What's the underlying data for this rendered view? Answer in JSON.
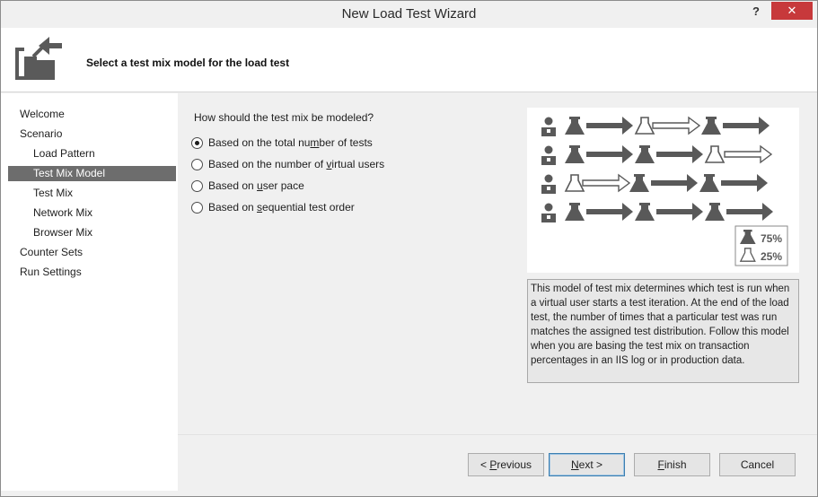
{
  "window": {
    "title": "New Load Test Wizard",
    "help_glyph": "?",
    "close_glyph": "✕"
  },
  "header": {
    "heading": "Select a test mix model for the load test",
    "icon": "wizard-icon"
  },
  "nav": {
    "items": [
      {
        "label": "Welcome",
        "level": "top"
      },
      {
        "label": "Scenario",
        "level": "top"
      },
      {
        "label": "Load Pattern",
        "level": "sub"
      },
      {
        "label": "Test Mix Model",
        "level": "sub",
        "selected": true
      },
      {
        "label": "Test Mix",
        "level": "sub"
      },
      {
        "label": "Network Mix",
        "level": "sub"
      },
      {
        "label": "Browser Mix",
        "level": "sub"
      },
      {
        "label": "Counter Sets",
        "level": "top"
      },
      {
        "label": "Run Settings",
        "level": "top"
      }
    ]
  },
  "content": {
    "question": "How should the test mix be modeled?",
    "options": [
      {
        "pre": "Based on the total nu",
        "accel": "m",
        "post": "ber of tests",
        "checked": true
      },
      {
        "pre": "Based on the number of ",
        "accel": "v",
        "post": "irtual users",
        "checked": false
      },
      {
        "pre": "Based on ",
        "accel": "u",
        "post": "ser pace",
        "checked": false
      },
      {
        "pre": "Based on ",
        "accel": "s",
        "post": "equential test order",
        "checked": false
      }
    ],
    "legend": {
      "dark_pct": "75%",
      "light_pct": "25%"
    },
    "description": "This model of test mix determines which test is run when a virtual user starts a test iteration. At the end of the load test, the number of times that a particular test was run matches the assigned test distribution. Follow this model when you are basing the test mix on transaction percentages in an IIS log or in production data."
  },
  "buttons": {
    "previous": {
      "pre": "< ",
      "accel": "P",
      "post": "revious"
    },
    "next": {
      "pre": "",
      "accel": "N",
      "post": "ext >"
    },
    "finish": {
      "pre": "",
      "accel": "F",
      "post": "inish"
    },
    "cancel": {
      "label": "Cancel"
    }
  },
  "colors": {
    "selection": "#6d6d6d",
    "close_button": "#c7393b",
    "illustration_dark": "#595959"
  }
}
